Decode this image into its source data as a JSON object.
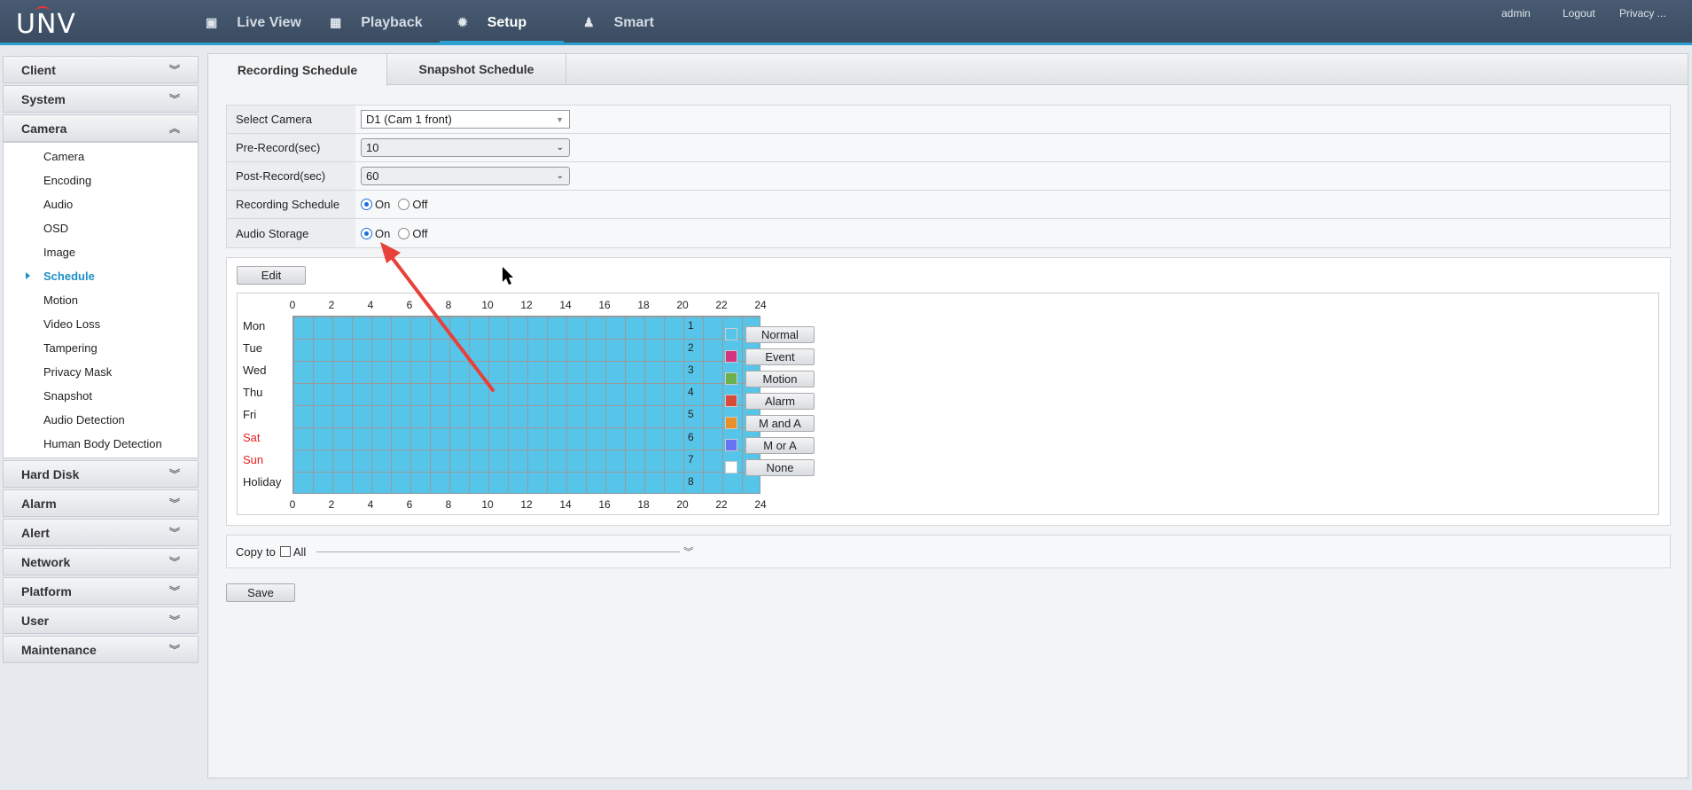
{
  "header": {
    "logo": "UNV",
    "nav": [
      {
        "label": "Live View",
        "icon": "monitor-icon"
      },
      {
        "label": "Playback",
        "icon": "film-icon"
      },
      {
        "label": "Setup",
        "icon": "gear-icon"
      },
      {
        "label": "Smart",
        "icon": "person-search-icon"
      }
    ],
    "user": "admin",
    "logout": "Logout",
    "privacy": "Privacy ..."
  },
  "sidebar": {
    "sections": [
      "Client",
      "System",
      "Camera",
      "Hard Disk",
      "Alarm",
      "Alert",
      "Network",
      "Platform",
      "User",
      "Maintenance"
    ],
    "camera_items": [
      "Camera",
      "Encoding",
      "Audio",
      "OSD",
      "Image",
      "Schedule",
      "Motion",
      "Video Loss",
      "Tampering",
      "Privacy Mask",
      "Snapshot",
      "Audio Detection",
      "Human Body Detection"
    ],
    "active_item": "Schedule"
  },
  "tabs": [
    "Recording Schedule",
    "Snapshot Schedule"
  ],
  "form": {
    "select_camera_label": "Select Camera",
    "select_camera_value": "D1 (Cam 1 front)",
    "pre_record_label": "Pre-Record(sec)",
    "pre_record_value": "10",
    "post_record_label": "Post-Record(sec)",
    "post_record_value": "60",
    "recording_schedule_label": "Recording Schedule",
    "audio_storage_label": "Audio Storage",
    "on": "On",
    "off": "Off",
    "recording_schedule": "On",
    "audio_storage": "On"
  },
  "schedule": {
    "edit": "Edit",
    "hours": [
      "0",
      "2",
      "4",
      "6",
      "8",
      "10",
      "12",
      "14",
      "16",
      "18",
      "20",
      "22",
      "24"
    ],
    "days": [
      "Mon",
      "Tue",
      "Wed",
      "Thu",
      "Fri",
      "Sat",
      "Sun",
      "Holiday"
    ],
    "row_numbers": [
      "1",
      "2",
      "3",
      "4",
      "5",
      "6",
      "7",
      "8"
    ],
    "fill_mode": "Normal",
    "legend": [
      {
        "label": "Normal",
        "color": "#56c5e9"
      },
      {
        "label": "Event",
        "color": "#d6347f"
      },
      {
        "label": "Motion",
        "color": "#6ab04c"
      },
      {
        "label": "Alarm",
        "color": "#d94a38"
      },
      {
        "label": "M and A",
        "color": "#e8912a"
      },
      {
        "label": "M or A",
        "color": "#6673f5"
      },
      {
        "label": "None",
        "color": "#ffffff"
      }
    ]
  },
  "copy": {
    "label": "Copy to",
    "all": "All"
  },
  "save": "Save"
}
